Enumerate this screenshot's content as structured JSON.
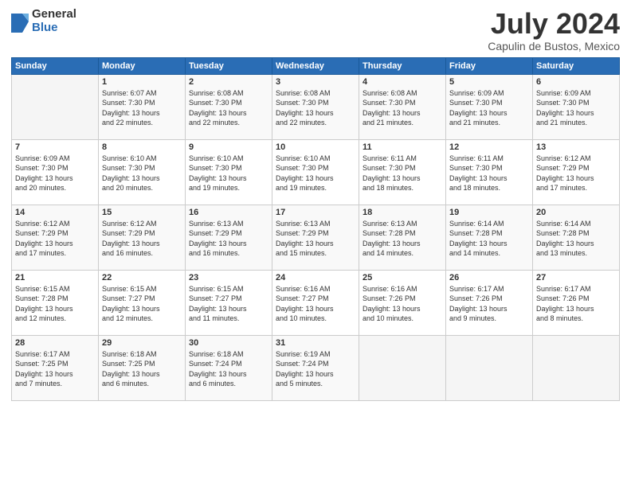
{
  "header": {
    "logo_general": "General",
    "logo_blue": "Blue",
    "month_title": "July 2024",
    "location": "Capulin de Bustos, Mexico"
  },
  "days_of_week": [
    "Sunday",
    "Monday",
    "Tuesday",
    "Wednesday",
    "Thursday",
    "Friday",
    "Saturday"
  ],
  "weeks": [
    [
      {
        "day": "",
        "sunrise": "",
        "sunset": "",
        "daylight": ""
      },
      {
        "day": "1",
        "sunrise": "Sunrise: 6:07 AM",
        "sunset": "Sunset: 7:30 PM",
        "daylight": "Daylight: 13 hours and 22 minutes."
      },
      {
        "day": "2",
        "sunrise": "Sunrise: 6:08 AM",
        "sunset": "Sunset: 7:30 PM",
        "daylight": "Daylight: 13 hours and 22 minutes."
      },
      {
        "day": "3",
        "sunrise": "Sunrise: 6:08 AM",
        "sunset": "Sunset: 7:30 PM",
        "daylight": "Daylight: 13 hours and 22 minutes."
      },
      {
        "day": "4",
        "sunrise": "Sunrise: 6:08 AM",
        "sunset": "Sunset: 7:30 PM",
        "daylight": "Daylight: 13 hours and 21 minutes."
      },
      {
        "day": "5",
        "sunrise": "Sunrise: 6:09 AM",
        "sunset": "Sunset: 7:30 PM",
        "daylight": "Daylight: 13 hours and 21 minutes."
      },
      {
        "day": "6",
        "sunrise": "Sunrise: 6:09 AM",
        "sunset": "Sunset: 7:30 PM",
        "daylight": "Daylight: 13 hours and 21 minutes."
      }
    ],
    [
      {
        "day": "7",
        "sunrise": "Sunrise: 6:09 AM",
        "sunset": "Sunset: 7:30 PM",
        "daylight": "Daylight: 13 hours and 20 minutes."
      },
      {
        "day": "8",
        "sunrise": "Sunrise: 6:10 AM",
        "sunset": "Sunset: 7:30 PM",
        "daylight": "Daylight: 13 hours and 20 minutes."
      },
      {
        "day": "9",
        "sunrise": "Sunrise: 6:10 AM",
        "sunset": "Sunset: 7:30 PM",
        "daylight": "Daylight: 13 hours and 19 minutes."
      },
      {
        "day": "10",
        "sunrise": "Sunrise: 6:10 AM",
        "sunset": "Sunset: 7:30 PM",
        "daylight": "Daylight: 13 hours and 19 minutes."
      },
      {
        "day": "11",
        "sunrise": "Sunrise: 6:11 AM",
        "sunset": "Sunset: 7:30 PM",
        "daylight": "Daylight: 13 hours and 18 minutes."
      },
      {
        "day": "12",
        "sunrise": "Sunrise: 6:11 AM",
        "sunset": "Sunset: 7:30 PM",
        "daylight": "Daylight: 13 hours and 18 minutes."
      },
      {
        "day": "13",
        "sunrise": "Sunrise: 6:12 AM",
        "sunset": "Sunset: 7:29 PM",
        "daylight": "Daylight: 13 hours and 17 minutes."
      }
    ],
    [
      {
        "day": "14",
        "sunrise": "Sunrise: 6:12 AM",
        "sunset": "Sunset: 7:29 PM",
        "daylight": "Daylight: 13 hours and 17 minutes."
      },
      {
        "day": "15",
        "sunrise": "Sunrise: 6:12 AM",
        "sunset": "Sunset: 7:29 PM",
        "daylight": "Daylight: 13 hours and 16 minutes."
      },
      {
        "day": "16",
        "sunrise": "Sunrise: 6:13 AM",
        "sunset": "Sunset: 7:29 PM",
        "daylight": "Daylight: 13 hours and 16 minutes."
      },
      {
        "day": "17",
        "sunrise": "Sunrise: 6:13 AM",
        "sunset": "Sunset: 7:29 PM",
        "daylight": "Daylight: 13 hours and 15 minutes."
      },
      {
        "day": "18",
        "sunrise": "Sunrise: 6:13 AM",
        "sunset": "Sunset: 7:28 PM",
        "daylight": "Daylight: 13 hours and 14 minutes."
      },
      {
        "day": "19",
        "sunrise": "Sunrise: 6:14 AM",
        "sunset": "Sunset: 7:28 PM",
        "daylight": "Daylight: 13 hours and 14 minutes."
      },
      {
        "day": "20",
        "sunrise": "Sunrise: 6:14 AM",
        "sunset": "Sunset: 7:28 PM",
        "daylight": "Daylight: 13 hours and 13 minutes."
      }
    ],
    [
      {
        "day": "21",
        "sunrise": "Sunrise: 6:15 AM",
        "sunset": "Sunset: 7:28 PM",
        "daylight": "Daylight: 13 hours and 12 minutes."
      },
      {
        "day": "22",
        "sunrise": "Sunrise: 6:15 AM",
        "sunset": "Sunset: 7:27 PM",
        "daylight": "Daylight: 13 hours and 12 minutes."
      },
      {
        "day": "23",
        "sunrise": "Sunrise: 6:15 AM",
        "sunset": "Sunset: 7:27 PM",
        "daylight": "Daylight: 13 hours and 11 minutes."
      },
      {
        "day": "24",
        "sunrise": "Sunrise: 6:16 AM",
        "sunset": "Sunset: 7:27 PM",
        "daylight": "Daylight: 13 hours and 10 minutes."
      },
      {
        "day": "25",
        "sunrise": "Sunrise: 6:16 AM",
        "sunset": "Sunset: 7:26 PM",
        "daylight": "Daylight: 13 hours and 10 minutes."
      },
      {
        "day": "26",
        "sunrise": "Sunrise: 6:17 AM",
        "sunset": "Sunset: 7:26 PM",
        "daylight": "Daylight: 13 hours and 9 minutes."
      },
      {
        "day": "27",
        "sunrise": "Sunrise: 6:17 AM",
        "sunset": "Sunset: 7:26 PM",
        "daylight": "Daylight: 13 hours and 8 minutes."
      }
    ],
    [
      {
        "day": "28",
        "sunrise": "Sunrise: 6:17 AM",
        "sunset": "Sunset: 7:25 PM",
        "daylight": "Daylight: 13 hours and 7 minutes."
      },
      {
        "day": "29",
        "sunrise": "Sunrise: 6:18 AM",
        "sunset": "Sunset: 7:25 PM",
        "daylight": "Daylight: 13 hours and 6 minutes."
      },
      {
        "day": "30",
        "sunrise": "Sunrise: 6:18 AM",
        "sunset": "Sunset: 7:24 PM",
        "daylight": "Daylight: 13 hours and 6 minutes."
      },
      {
        "day": "31",
        "sunrise": "Sunrise: 6:19 AM",
        "sunset": "Sunset: 7:24 PM",
        "daylight": "Daylight: 13 hours and 5 minutes."
      },
      {
        "day": "",
        "sunrise": "",
        "sunset": "",
        "daylight": ""
      },
      {
        "day": "",
        "sunrise": "",
        "sunset": "",
        "daylight": ""
      },
      {
        "day": "",
        "sunrise": "",
        "sunset": "",
        "daylight": ""
      }
    ]
  ]
}
